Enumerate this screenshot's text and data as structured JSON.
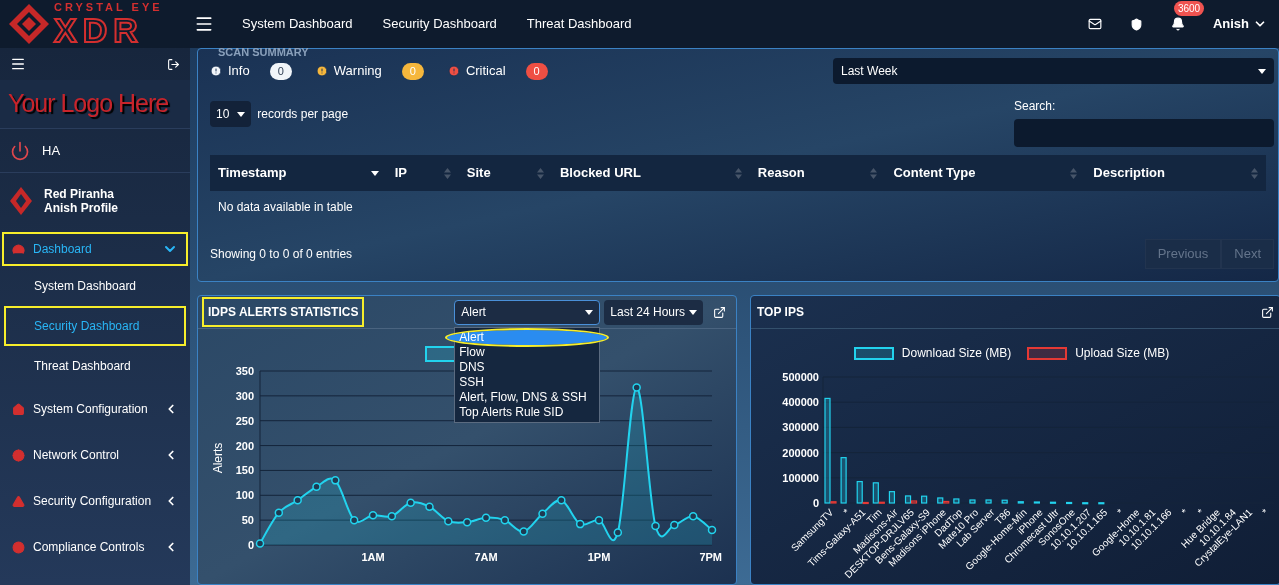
{
  "brand": {
    "tagline": "CRYSTAL EYE",
    "name": "XDR"
  },
  "top_nav": {
    "links": [
      "System Dashboard",
      "Security Dashboard",
      "Threat Dashboard"
    ],
    "notification_count": "3600",
    "user": "Anish"
  },
  "sidebar": {
    "logo_text": "Your Logo Here",
    "ha_label": "HA",
    "profile": {
      "name": "Red Piranha",
      "subtitle": "Anish Profile"
    },
    "items": [
      {
        "label": "Dashboard",
        "expanded": true,
        "selected": true,
        "highlighted": true,
        "children": [
          {
            "label": "System Dashboard",
            "selected": false,
            "highlighted": false
          },
          {
            "label": "Security Dashboard",
            "selected": true,
            "highlighted": true
          },
          {
            "label": "Threat Dashboard",
            "selected": false,
            "highlighted": false
          }
        ]
      },
      {
        "label": "System Configuration",
        "expanded": false,
        "selected": false,
        "highlighted": false
      },
      {
        "label": "Network Control",
        "expanded": false,
        "selected": false,
        "highlighted": false
      },
      {
        "label": "Security Configuration",
        "expanded": false,
        "selected": false,
        "highlighted": false
      },
      {
        "label": "Compliance Controls",
        "expanded": false,
        "selected": false,
        "highlighted": false
      }
    ]
  },
  "scan_summary": {
    "title": "SCAN SUMMARY",
    "filters": [
      {
        "label": "Info",
        "count": "0",
        "color": "#f1f5f9"
      },
      {
        "label": "Warning",
        "count": "0",
        "color": "#f6b73c"
      },
      {
        "label": "Critical",
        "count": "0",
        "color": "#ef4f43"
      }
    ],
    "period": "Last Week",
    "page_size": "10",
    "page_size_label": "records per page",
    "search_label": "Search:",
    "table": {
      "columns": [
        {
          "label": "Timestamp",
          "sorted": true
        },
        {
          "label": "IP",
          "sorted": false
        },
        {
          "label": "Site",
          "sorted": false
        },
        {
          "label": "Blocked URL",
          "sorted": false
        },
        {
          "label": "Reason",
          "sorted": false
        },
        {
          "label": "Content Type",
          "sorted": false
        },
        {
          "label": "Description",
          "sorted": false
        }
      ],
      "empty_text": "No data available in table"
    },
    "info": "Showing 0 to 0 of 0 entries",
    "pagination": [
      {
        "label": "Previous",
        "disabled": true
      },
      {
        "label": "Next",
        "disabled": true
      }
    ]
  },
  "idps": {
    "title": "IDPS ALERTS STATISTICS",
    "highlighted": true,
    "type_select": {
      "value": "Alert",
      "expanded": true,
      "options": [
        {
          "label": "Alert",
          "selected": true,
          "highlighted": true
        },
        {
          "label": "Flow",
          "selected": false,
          "highlighted": false
        },
        {
          "label": "DNS",
          "selected": false,
          "highlighted": false
        },
        {
          "label": "SSH",
          "selected": false,
          "highlighted": false
        },
        {
          "label": "Alert, Flow, DNS & SSH",
          "selected": false,
          "highlighted": false
        },
        {
          "label": "Top Alerts Rule SID",
          "selected": false,
          "highlighted": false
        }
      ]
    },
    "range_select": "Last 24 Hours",
    "time_labels": [
      "1AM",
      "7AM",
      "1PM",
      "7PM"
    ],
    "chart_data": {
      "type": "area",
      "ylabel": "Alerts",
      "grid": true,
      "series": [
        {
          "color": "#22d3ee",
          "values": [
            3,
            65,
            90,
            117,
            130,
            50,
            60,
            58,
            85,
            77,
            48,
            46,
            55,
            50,
            27,
            63,
            90,
            42,
            50,
            25,
            317,
            38,
            40,
            58,
            30
          ]
        }
      ],
      "ylim": [
        0,
        350
      ],
      "yticks": [
        0,
        50,
        100,
        150,
        200,
        250,
        300,
        350
      ]
    }
  },
  "top_ips": {
    "title": "TOP IPS",
    "chart_data": {
      "type": "bar",
      "legend": "top",
      "grid": true,
      "categories": [
        "SamsungTV",
        "*",
        "Tims-Galaxy-A51",
        "Tim",
        "Madisons-Air",
        "DESKTOP-DRJLV65",
        "Bens-Galaxy-S9",
        "Madisons iPhone",
        "DadTop",
        "Mate10 Pro",
        "Lab Server",
        "T86",
        "Google-Home-Min",
        "iPhone",
        "Chromecast Ultr",
        "SonosOne",
        "10.10.1.207",
        "10.10.1.165",
        "*",
        "Google-Home",
        "10.10.1.81",
        "10.10.1.166",
        "*",
        "*",
        "Hue Bridge",
        "10.10.1.84",
        "CrystalEye-LAN1",
        "*"
      ],
      "series": [
        {
          "name": "Download Size (MB)",
          "color": "#22d3ee",
          "values": [
            415000,
            180000,
            85000,
            80000,
            45000,
            28000,
            27000,
            20000,
            16000,
            12000,
            12000,
            11000,
            5000,
            4000,
            3000,
            2000,
            1000,
            1000,
            0,
            0,
            0,
            0,
            0,
            0,
            0,
            0,
            0,
            0
          ]
        },
        {
          "name": "Upload Size (MB)",
          "color": "#e53935",
          "values": [
            5000,
            0,
            2000,
            3000,
            0,
            8000,
            0,
            6000,
            0,
            0,
            0,
            0,
            0,
            0,
            0,
            0,
            0,
            0,
            0,
            0,
            0,
            0,
            0,
            0,
            0,
            0,
            0,
            0
          ]
        }
      ],
      "ylim": [
        0,
        500000
      ],
      "yticks": [
        0,
        100000,
        200000,
        300000,
        400000,
        500000
      ]
    }
  }
}
